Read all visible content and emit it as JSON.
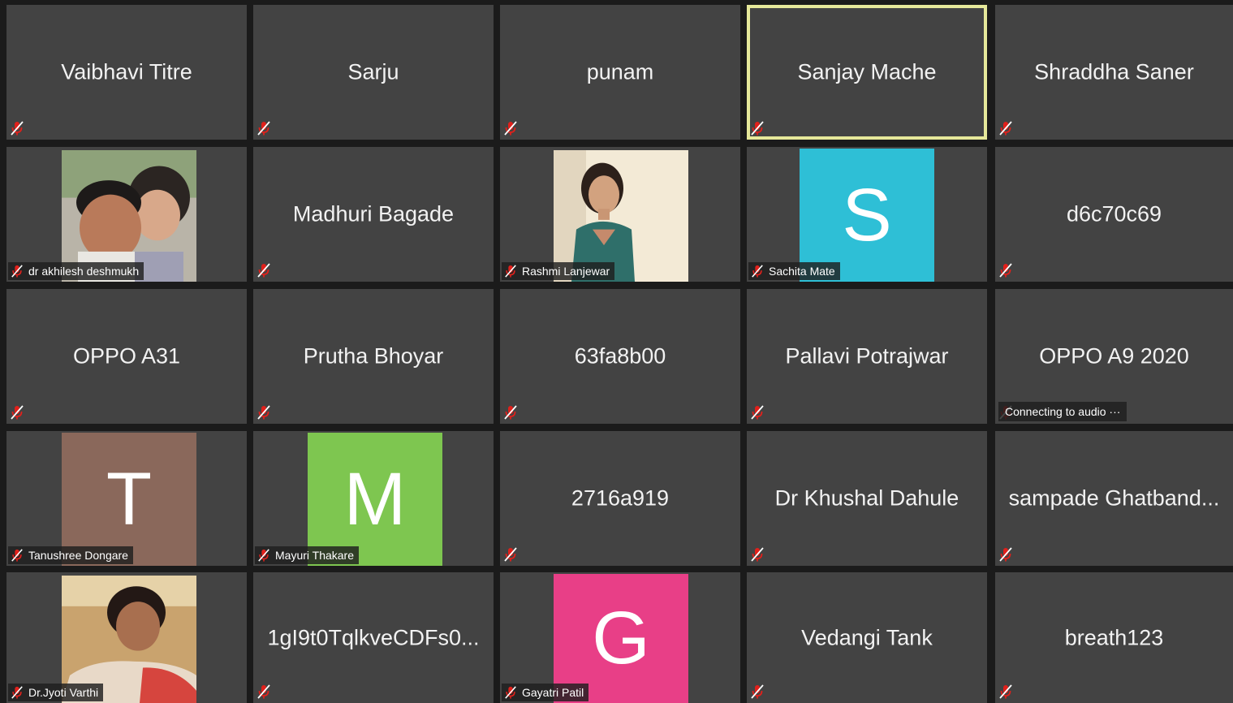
{
  "participants": [
    {
      "name": "Vaibhavi Titre",
      "kind": "name"
    },
    {
      "name": "Sarju",
      "kind": "name"
    },
    {
      "name": "punam",
      "kind": "name"
    },
    {
      "name": "Sanjay Mache",
      "kind": "name",
      "active_speaker": true
    },
    {
      "name": "Shraddha Saner",
      "kind": "name"
    },
    {
      "name": "dr akhilesh deshmukh",
      "kind": "photo",
      "photo": "man-and-child"
    },
    {
      "name": "Madhuri Bagade",
      "kind": "name"
    },
    {
      "name": "Rashmi Lanjewar",
      "kind": "photo",
      "photo": "girl-portrait"
    },
    {
      "name": "Sachita Mate",
      "kind": "avatar",
      "initial": "S",
      "color": "#2ebfd6"
    },
    {
      "name": "d6c70c69",
      "kind": "name"
    },
    {
      "name": "OPPO A31",
      "kind": "name"
    },
    {
      "name": "Prutha Bhoyar",
      "kind": "name"
    },
    {
      "name": "63fa8b00",
      "kind": "name"
    },
    {
      "name": "Pallavi Potrajwar",
      "kind": "name"
    },
    {
      "name": "OPPO A9 2020",
      "kind": "name",
      "status": "Connecting to audio ···"
    },
    {
      "name": "Tanushree Dongare",
      "kind": "avatar",
      "initial": "T",
      "color": "#8a685b"
    },
    {
      "name": "Mayuri Thakare",
      "kind": "avatar",
      "initial": "M",
      "color": "#7ec650"
    },
    {
      "name": "2716a919",
      "kind": "name"
    },
    {
      "name": "Dr Khushal Dahule",
      "kind": "name"
    },
    {
      "name": "sampade Ghatband...",
      "kind": "name"
    },
    {
      "name": "Dr.Jyoti Varthi",
      "kind": "photo",
      "photo": "woman-portrait"
    },
    {
      "name": "1gI9t0TqlkveCDFs0...",
      "kind": "name"
    },
    {
      "name": "Gayatri Patil",
      "kind": "avatar",
      "initial": "G",
      "color": "#e83f87"
    },
    {
      "name": "Vedangi Tank",
      "kind": "name"
    },
    {
      "name": "breath123",
      "kind": "name"
    }
  ],
  "icons": {
    "muted_mic": "muted-mic-icon"
  },
  "colors": {
    "tile_background": "#434343",
    "grid_background": "#1b1b1b",
    "active_speaker_border": "#e6e89a",
    "muted_icon": "#e0201b"
  }
}
